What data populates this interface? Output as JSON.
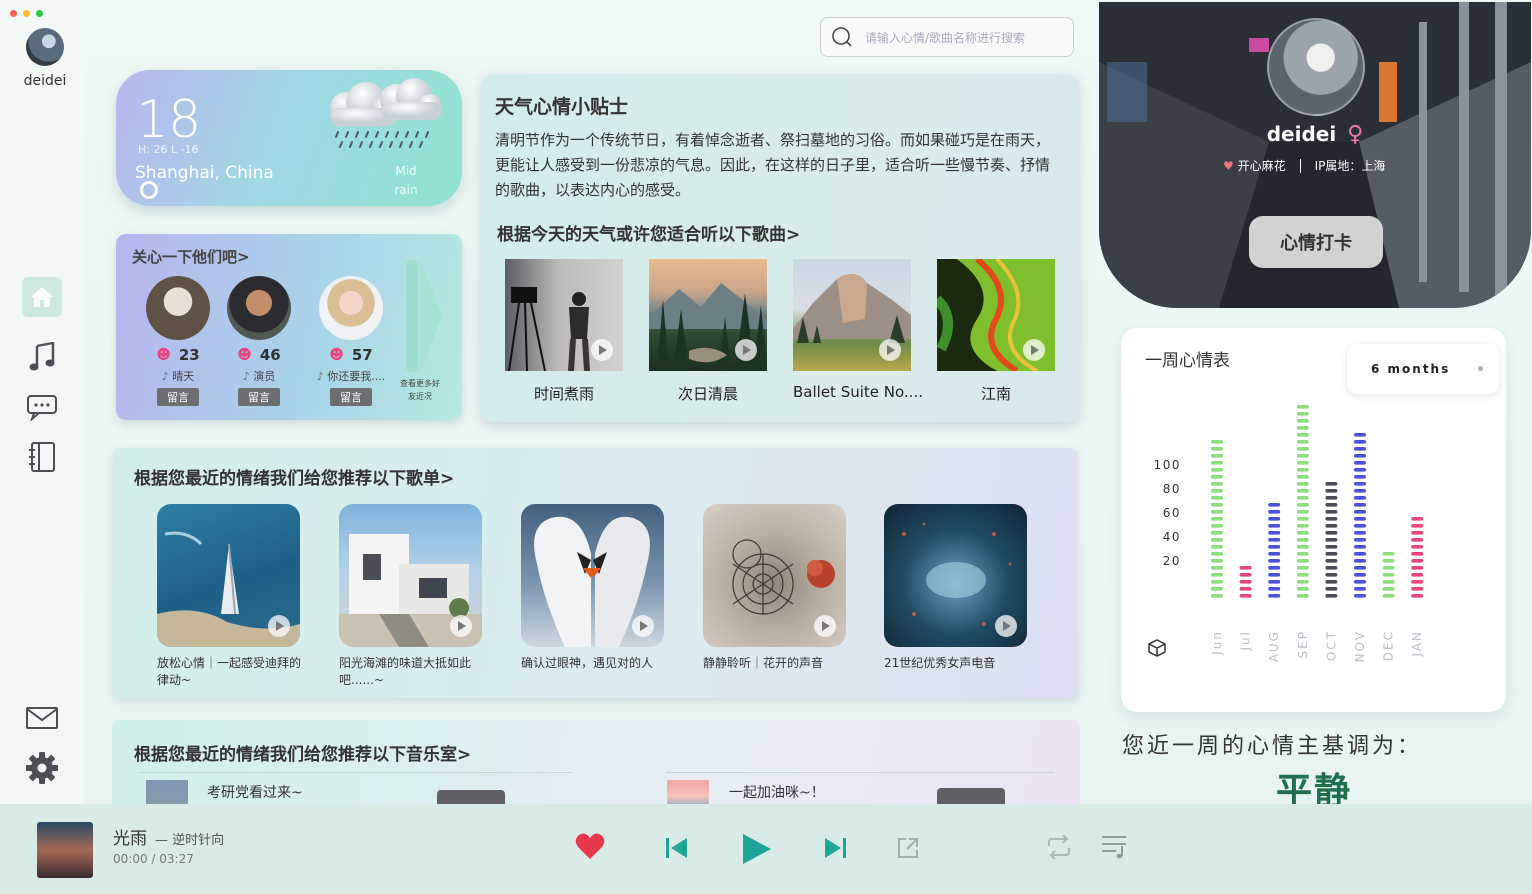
{
  "user": {
    "name": "deidei"
  },
  "search": {
    "placeholder": "请输入心情/歌曲名称进行搜索"
  },
  "weather": {
    "temp": "18",
    "hl": "H: 26    L -16",
    "city": "Shanghai, China",
    "condition": "Mid rain"
  },
  "care": {
    "title": "关心一下他们吧>",
    "friends": [
      {
        "mood": "23",
        "song": "晴天",
        "msg": "留言"
      },
      {
        "mood": "46",
        "song": "演员",
        "msg": "留言"
      },
      {
        "mood": "57",
        "song": "你还要我....",
        "msg": "留言"
      }
    ],
    "more": "查看更多好友近况"
  },
  "tips": {
    "title": "天气心情小贴士",
    "body": "清明节作为一个传统节日，有着悼念逝者、祭扫墓地的习俗。而如果碰巧是在雨天，更能让人感受到一份悲凉的气息。因此，在这样的日子里，适合听一些慢节奏、抒情的歌曲，以表达内心的感受。",
    "subtitle": "根据今天的天气或许您适合听以下歌曲>",
    "songs": [
      "时间煮雨",
      "次日清晨",
      "Ballet Suite No....",
      "江南"
    ]
  },
  "playlist": {
    "title": "根据您最近的情绪我们给您推荐以下歌单>",
    "items": [
      "放松心情｜一起感受迪拜的律动~",
      "阳光海滩的味道大抵如此吧......~",
      "确认过眼神，遇见对的人",
      "静静聆听｜花开的声音",
      "21世纪优秀女声电音"
    ]
  },
  "studio": {
    "title": "根据您最近的情绪我们给您推荐以下音乐室>",
    "rooms": [
      "考研党看过来~",
      "一起加油咪~！"
    ]
  },
  "profile": {
    "name": "deidei",
    "tag": "开心麻花",
    "ip": "IP属地：上海",
    "checkin": "心情打卡"
  },
  "mood_chart": {
    "title": "一周心情表",
    "range": "6 months"
  },
  "chart_data": {
    "type": "bar",
    "title": "一周心情表",
    "categories": [
      "Jun",
      "Jul",
      "AUG",
      "SEP",
      "OCT",
      "NOV",
      "DEC",
      "JAN"
    ],
    "values": [
      90,
      20,
      55,
      112,
      66,
      95,
      26,
      49
    ],
    "colors": [
      "#8ede7c",
      "#e7457f",
      "#4b52d6",
      "#8ede7c",
      "#4a4d57",
      "#4b52d6",
      "#8ede7c",
      "#e7457f"
    ],
    "yticks": [
      "100",
      "80",
      "60",
      "40",
      "20"
    ],
    "ylim": [
      0,
      115
    ]
  },
  "summary": {
    "label": "您近一周的心情主基调为：",
    "value": "平静"
  },
  "player": {
    "title": "光雨",
    "artist": "— 逆时针向",
    "time": "00:00 / 03:27"
  }
}
